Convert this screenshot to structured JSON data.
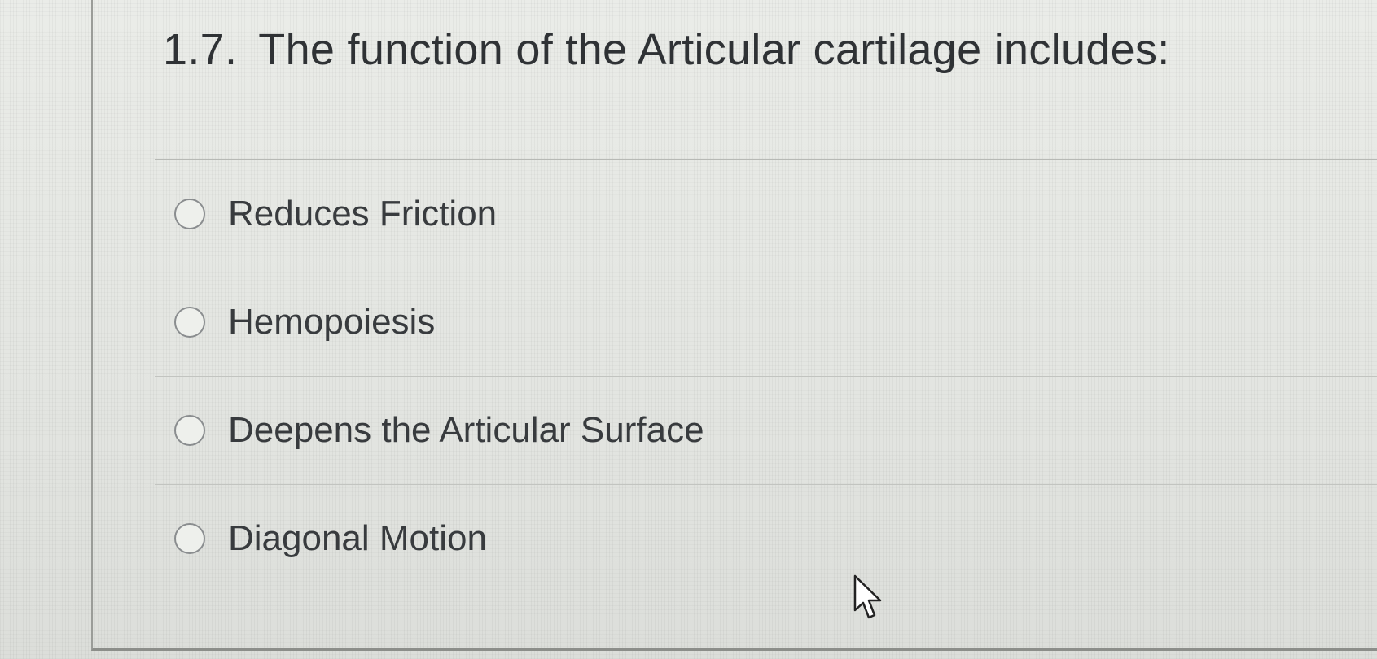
{
  "question": {
    "number": "1.7.",
    "text": "The function of the Articular cartilage includes:"
  },
  "options": [
    {
      "label": "Reduces Friction",
      "selected": false
    },
    {
      "label": "Hemopoiesis",
      "selected": false
    },
    {
      "label": "Deepens the Articular Surface",
      "selected": false
    },
    {
      "label": "Diagonal Motion",
      "selected": false
    }
  ],
  "icons": {
    "radio": "radio-button-icon",
    "cursor": "mouse-pointer-icon"
  },
  "colors": {
    "background": "#e4e6e2",
    "text": "#383b3e",
    "radio_border": "#8a8d8f",
    "divider": "#c2c4c0"
  }
}
